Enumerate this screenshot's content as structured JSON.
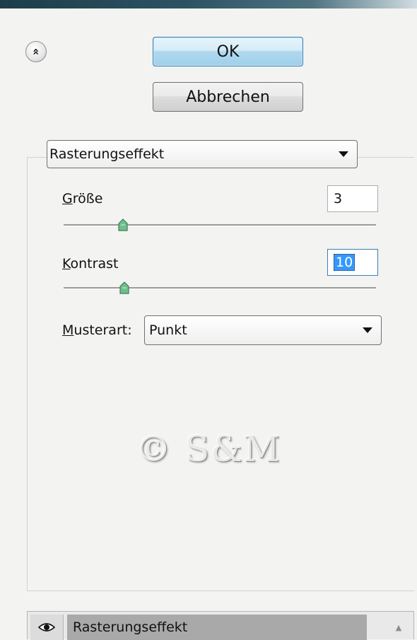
{
  "dialog": {
    "collapse_glyph": "«",
    "ok_label": "OK",
    "cancel_label": "Abbrechen"
  },
  "filter_select": {
    "value": "Rasterungseffekt"
  },
  "size": {
    "label": "Größe",
    "value": "3",
    "slider_level": 0.19
  },
  "contrast": {
    "label": "Kontrast",
    "value": "10",
    "slider_level": 0.195
  },
  "pattern": {
    "label": "Musterart:",
    "value": "Punkt"
  },
  "watermark": {
    "text": "© S&M"
  },
  "layers": {
    "items": [
      {
        "label": "Rasterungseffekt",
        "visible": true
      }
    ]
  },
  "icons": {
    "collapse": "double-chevron-up-icon",
    "dropdown": "dropdown-arrow-icon",
    "eye": "eye-icon",
    "scroll_up": "scroll-up-arrow-icon"
  },
  "colors": {
    "accent": "#3399ff",
    "ok_border": "#3c7fb1",
    "thumb": "#6fbf8c",
    "layer_selected": "#a9a9a9"
  }
}
